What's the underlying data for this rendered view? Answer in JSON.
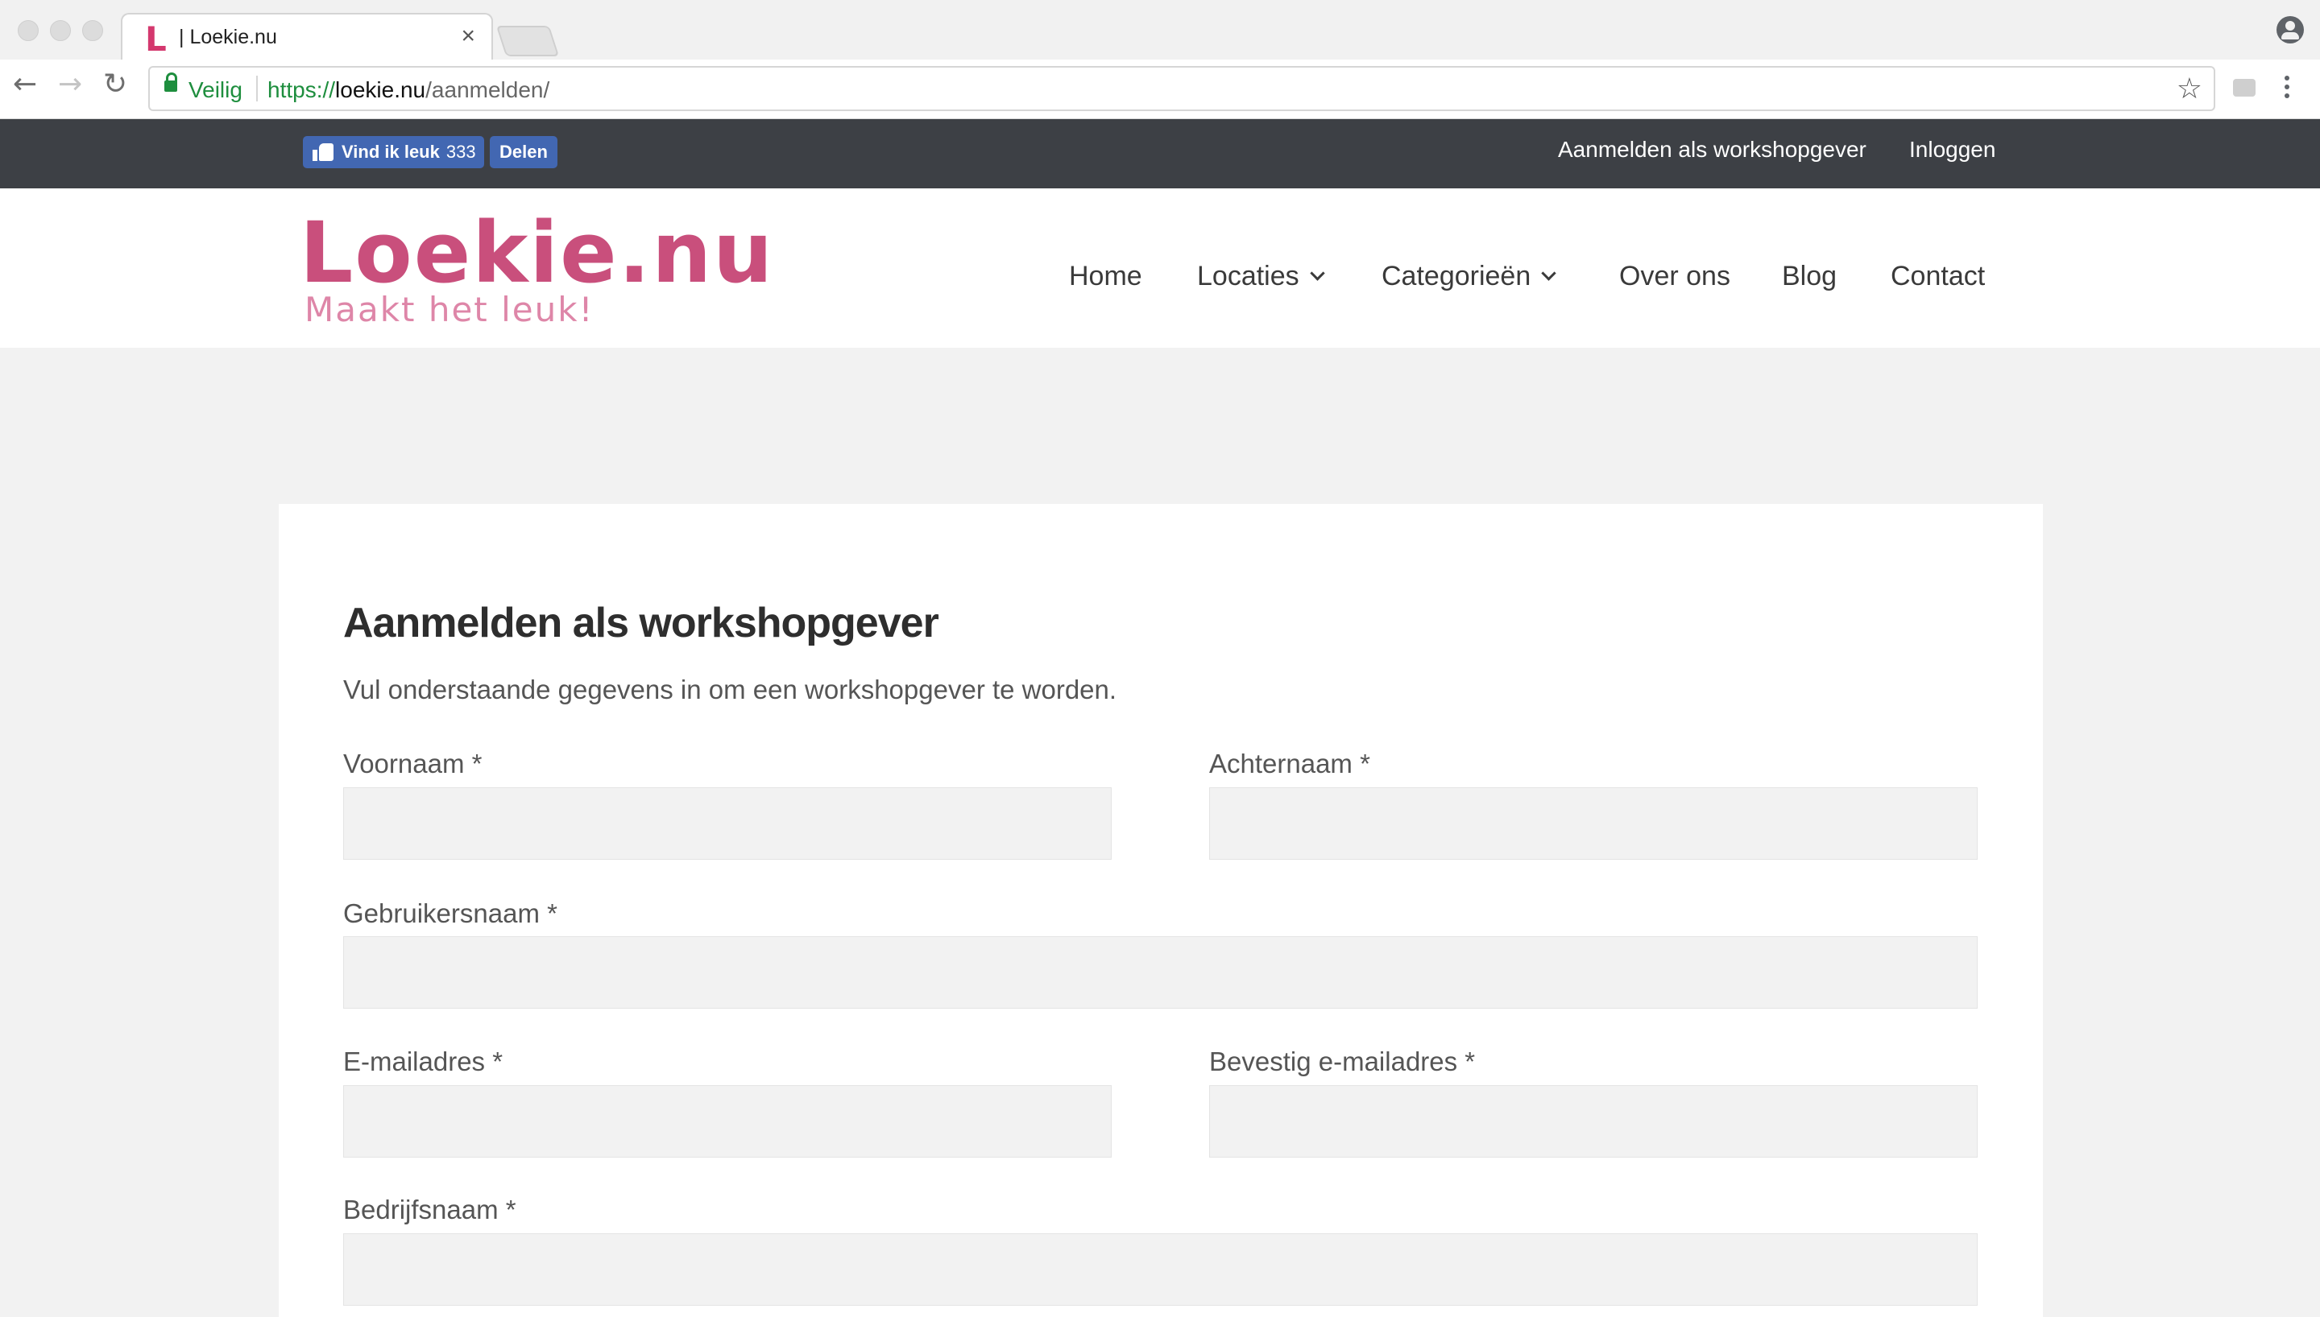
{
  "browser": {
    "tab_favicon": "L",
    "tab_title": "| Loekie.nu",
    "tab_close": "×",
    "secure_label": "Veilig",
    "url_scheme": "https://",
    "url_host": "loekie.nu",
    "url_path": "/aanmelden/",
    "icons": [
      "back-icon",
      "forward-icon",
      "reload-icon",
      "lock-icon",
      "star-icon",
      "profile-icon",
      "menu-icon"
    ]
  },
  "topbar": {
    "like_label": "Vind ik leuk",
    "like_count": "333",
    "share_label": "Delen",
    "links": [
      "Aanmelden als workshopgever",
      "Inloggen"
    ]
  },
  "header": {
    "logo": "Loekie.nu",
    "tagline": "Maakt het leuk!",
    "nav": [
      "Home",
      "Locaties",
      "Categorieën",
      "Over ons",
      "Blog",
      "Contact"
    ]
  },
  "form": {
    "title": "Aanmelden als workshopgever",
    "intro": "Vul onderstaande gegevens in om een workshopgever te worden.",
    "fields": {
      "voornaam": {
        "label": "Voornaam *",
        "value": ""
      },
      "achternaam": {
        "label": "Achternaam *",
        "value": ""
      },
      "gebruikersnaam": {
        "label": "Gebruikersnaam *",
        "value": ""
      },
      "email": {
        "label": "E-mailadres *",
        "value": ""
      },
      "email_confirm": {
        "label": "Bevestig e-mailadres *",
        "value": ""
      },
      "bedrijfsnaam": {
        "label": "Bedrijfsnaam *",
        "value": ""
      }
    }
  },
  "colors": {
    "brand_pink": "#c94f7c",
    "tagline_pink": "#de86a8",
    "topbar_bg": "#3d4045",
    "facebook_blue": "#4267b2",
    "page_bg": "#f2f2f2"
  }
}
